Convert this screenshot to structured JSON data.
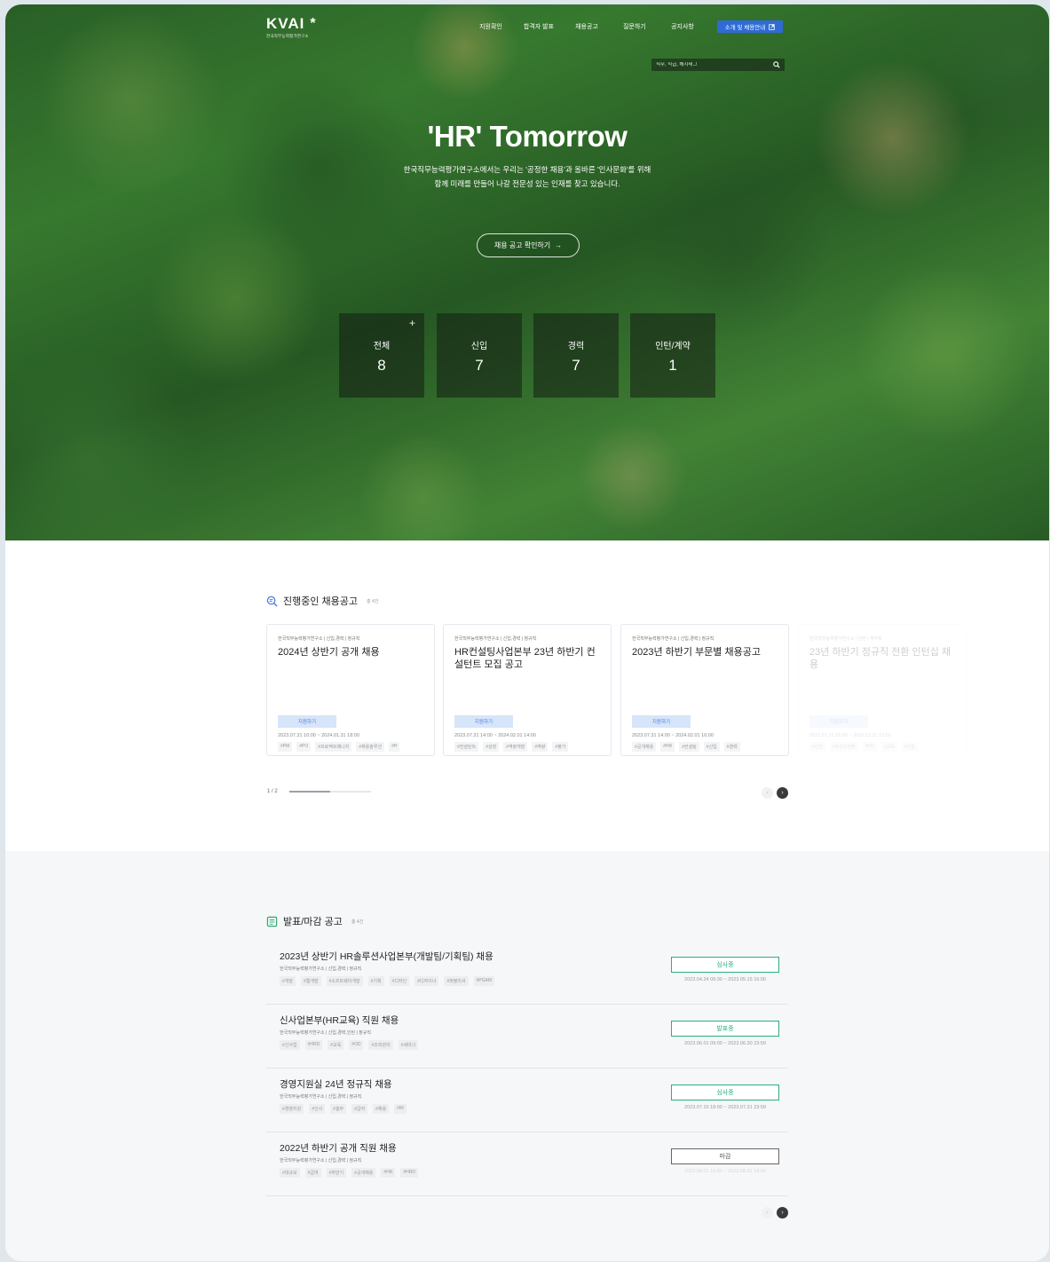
{
  "header": {
    "logo": "KVAI",
    "logo_star": "*",
    "logo_sub": "한국직무능력평가연구소",
    "nav": [
      "지원확인",
      "합격자 발표",
      "채용공고",
      "질문하기",
      "공지사항"
    ],
    "cta": "소개 및 채용안내",
    "search_placeholder": "직무, 직급, 해시태그"
  },
  "hero": {
    "title": "'HR' Tomorrow",
    "desc_line1": "한국직무능력평가연구소에서는 우리는 '공정한 채용'과 올바른 '인사문화'를 위해",
    "desc_line2": "함께 미래를 만들어 나갈 전문성 있는 인재를 찾고 있습니다.",
    "button": "채용 공고 확인하기",
    "stats": [
      {
        "label": "전체",
        "value": "8"
      },
      {
        "label": "신입",
        "value": "7"
      },
      {
        "label": "경력",
        "value": "7"
      },
      {
        "label": "인턴/계약",
        "value": "1"
      }
    ]
  },
  "active": {
    "title": "진행중인 채용공고",
    "count": "총 4건",
    "cards": [
      {
        "meta": "한국직무능력평가연구소 | 신입,경력 | 정규직",
        "title": "2024년 상반기 공개 채용",
        "apply": "지원하기",
        "date": "2023.07.31 10:00 ~ 2024.01.31 18:00",
        "tags": [
          "#PM",
          "#PO",
          "#프로젝트매니저",
          "#채용솔루션",
          "#H"
        ]
      },
      {
        "meta": "한국직무능력평가연구소 | 신입,경력 | 정규직",
        "title": "HR컨설팅사업본부 23년 하반기 컨설턴트 모집 공고",
        "apply": "지원하기",
        "date": "2023.07.31 14:00 ~ 2024.02.01 14:00",
        "tags": [
          "#컨설턴트",
          "#성장",
          "#역량개발",
          "#역량",
          "#평가"
        ]
      },
      {
        "meta": "한국직무능력평가연구소 | 신입,경력 | 정규직",
        "title": "2023년 하반기 부문별 채용공고",
        "apply": "지원하기",
        "date": "2023.07.31 14:00 ~ 2024.02.01 16:00",
        "tags": [
          "#공개채용",
          "#HR",
          "#컨설팅",
          "#신입",
          "#경력"
        ]
      },
      {
        "meta": "한국직무능력평가연구소 | 인턴 | 계약직",
        "title": "23년 하반기 정규직 전환 인턴십 채용",
        "apply": "지원하기",
        "date": "2023.07.31 15:00 ~ 2023.12.31 23:59",
        "tags": [
          "#인턴",
          "#정규직전환",
          "#HR",
          "#교육",
          "#성장"
        ]
      }
    ],
    "pager": "1 / 2",
    "progress": 0.5
  },
  "announce": {
    "title": "발표/마감 공고",
    "count": "총 4건",
    "items": [
      {
        "title": "2023년 상반기 HR솔루션사업본부(개발팀/기획팀) 채용",
        "meta": "한국직무능력평가연구소 | 신입,경력 | 정규직",
        "tags": [
          "#개발",
          "#웹개발",
          "#소프트웨어개발",
          "#기획",
          "#디자인",
          "#디자이너",
          "#퍼블리셔",
          "#PGAM"
        ],
        "status": "심사중",
        "period": "2023.04.24 09:30 ~ 2023.05.15 16:00"
      },
      {
        "title": "신사업본부(HR교육) 직원 채용",
        "meta": "한국직무능력평가연구소 | 신입,경력,인턴 | 정규직",
        "tags": [
          "#신사업",
          "#HRD",
          "#교육",
          "#OD",
          "#조직관리",
          "#세미나"
        ],
        "status": "발표중",
        "period": "2023.06.01 09:00 ~ 2023.06.30 23:59"
      },
      {
        "title": "경영지원실 24년 정규직 채용",
        "meta": "한국직무능력평가연구소 | 신입,경력 | 정규직",
        "tags": [
          "#경영지원",
          "#인사",
          "#총무",
          "#급여",
          "#채용",
          "#IR"
        ],
        "status": "심사중",
        "period": "2023.07.10 18:00 ~ 2023.07.31 23:59"
      },
      {
        "title": "2022년 하반기 공개 직원 채용",
        "meta": "한국직무능력평가연구소 | 신입,경력 | 정규직",
        "tags": [
          "#대규모",
          "#급여",
          "#하반기",
          "#공개채용",
          "#HR",
          "#HRD"
        ],
        "status": "마감",
        "period": "2022.08.01 10:00 ~ 2022.08.31 18:00"
      }
    ]
  },
  "colors": {
    "accent": "#2f6bd4",
    "status_green": "#28b07f",
    "apply_bg": "#d7e5fb"
  },
  "icons": {
    "search": "search-icon",
    "section_active": "magnify-list-icon",
    "section_announce": "clipboard-icon"
  }
}
